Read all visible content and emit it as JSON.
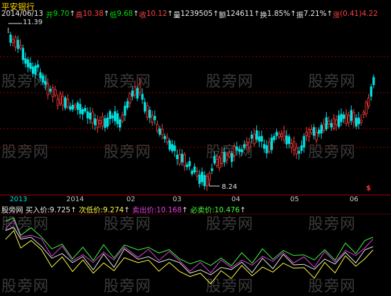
{
  "stock": {
    "name": "平安银行"
  },
  "quote": {
    "date": "2014/06/13",
    "open_label": "开",
    "open": "9.70",
    "high_label": "高",
    "high": "10.38",
    "low_label": "低",
    "low": "9.68",
    "close_label": "收",
    "close": "10.12",
    "volume_label": "量",
    "volume": "1239505",
    "amount_label": "额",
    "amount": "124611",
    "turnover_label": "换",
    "turnover": "1.85%",
    "amplitude_label": "振",
    "amplitude": "7.21%",
    "change_label": "涨",
    "change": "(0.41)",
    "change_pct": "4.22",
    "arrow": "↑"
  },
  "annotations": {
    "high_price": "11.39",
    "low_price": "8.24",
    "signal": "$"
  },
  "date_axis": [
    "2013",
    "2014",
    "02",
    "03",
    "04",
    "05",
    "06"
  ],
  "indicator": {
    "name": "股旁网",
    "buy_label": "买入价:",
    "buy_value": "9.725",
    "second_low_label": "次低价:",
    "second_low_value": "9.274",
    "sell_label": "卖出价:",
    "sell_value": "10.168",
    "must_sell_label": "必卖价:",
    "must_sell_value": "10.476",
    "arrow": "↑"
  },
  "watermark": "股旁网",
  "colors": {
    "up": "#ff3c3c",
    "down": "#00e0e0",
    "text_up": "#ff4040",
    "text_down": "#00e000",
    "title": "#ffd700",
    "grid": "#a00000",
    "buy": "#e8e8e8",
    "second_low": "#ffff40",
    "sell": "#e040e0",
    "must_sell": "#40ff40"
  }
}
